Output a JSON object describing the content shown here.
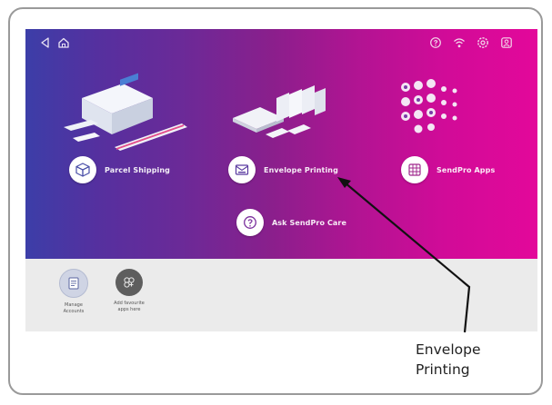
{
  "topbar": {
    "left_icons": [
      "back-icon",
      "home-icon"
    ],
    "right_icons": [
      "help-icon",
      "wifi-icon",
      "settings-icon",
      "account-icon"
    ]
  },
  "tiles": {
    "parcel_shipping": {
      "label": "Parcel Shipping",
      "icon": "package-icon"
    },
    "envelope_printing": {
      "label": "Envelope Printing",
      "icon": "envelope-printer-icon"
    },
    "sendpro_apps": {
      "label": "SendPro Apps",
      "icon": "apps-grid-icon"
    },
    "ask_sendpro_care": {
      "label": "Ask SendPro Care",
      "icon": "help-circle-icon"
    }
  },
  "dock": {
    "apps": [
      {
        "label": "Manage\nAccounts",
        "icon": "accounts-icon"
      },
      {
        "label": "Add favourite\napps here",
        "icon": "favorites-icon"
      }
    ]
  },
  "callout": {
    "text": "Envelope\nPrinting"
  },
  "colors": {
    "gradient_start": "#3c3ea8",
    "gradient_end": "#e3089a",
    "dock_background": "#ebebeb",
    "frame_border": "#9a9a9a"
  }
}
